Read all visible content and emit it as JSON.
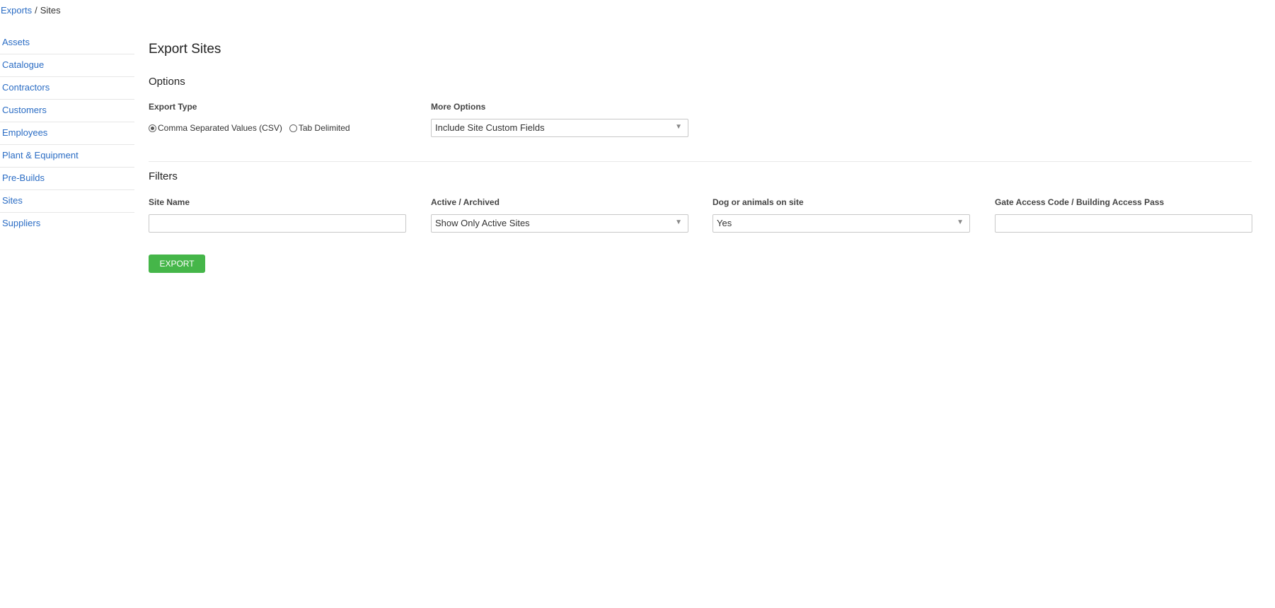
{
  "breadcrumb": {
    "parent": "Exports",
    "separator": "/",
    "current": "Sites"
  },
  "sidebar": {
    "items": [
      {
        "label": "Assets"
      },
      {
        "label": "Catalogue"
      },
      {
        "label": "Contractors"
      },
      {
        "label": "Customers"
      },
      {
        "label": "Employees"
      },
      {
        "label": "Plant & Equipment"
      },
      {
        "label": "Pre-Builds"
      },
      {
        "label": "Sites"
      },
      {
        "label": "Suppliers"
      }
    ]
  },
  "page": {
    "title": "Export Sites"
  },
  "options": {
    "title": "Options",
    "export_type": {
      "label": "Export Type",
      "choices": [
        {
          "label": "Comma Separated Values (CSV)",
          "selected": true
        },
        {
          "label": "Tab Delimited",
          "selected": false
        }
      ]
    },
    "more_options": {
      "label": "More Options",
      "value": "Include Site Custom Fields"
    }
  },
  "filters": {
    "title": "Filters",
    "site_name": {
      "label": "Site Name",
      "value": ""
    },
    "active_archived": {
      "label": "Active / Archived",
      "value": "Show Only Active Sites"
    },
    "dog_animals": {
      "label": "Dog or animals on site",
      "value": "Yes"
    },
    "gate_access": {
      "label": "Gate Access Code / Building Access Pass",
      "value": ""
    }
  },
  "actions": {
    "export_label": "EXPORT"
  },
  "icons": {
    "dropdown_caret": "chevron-down-icon",
    "radio_checked": "radio-checked-icon",
    "radio_unchecked": "radio-unchecked-icon"
  },
  "colors": {
    "link": "#2a6cc4",
    "export_button": "#45b649"
  }
}
